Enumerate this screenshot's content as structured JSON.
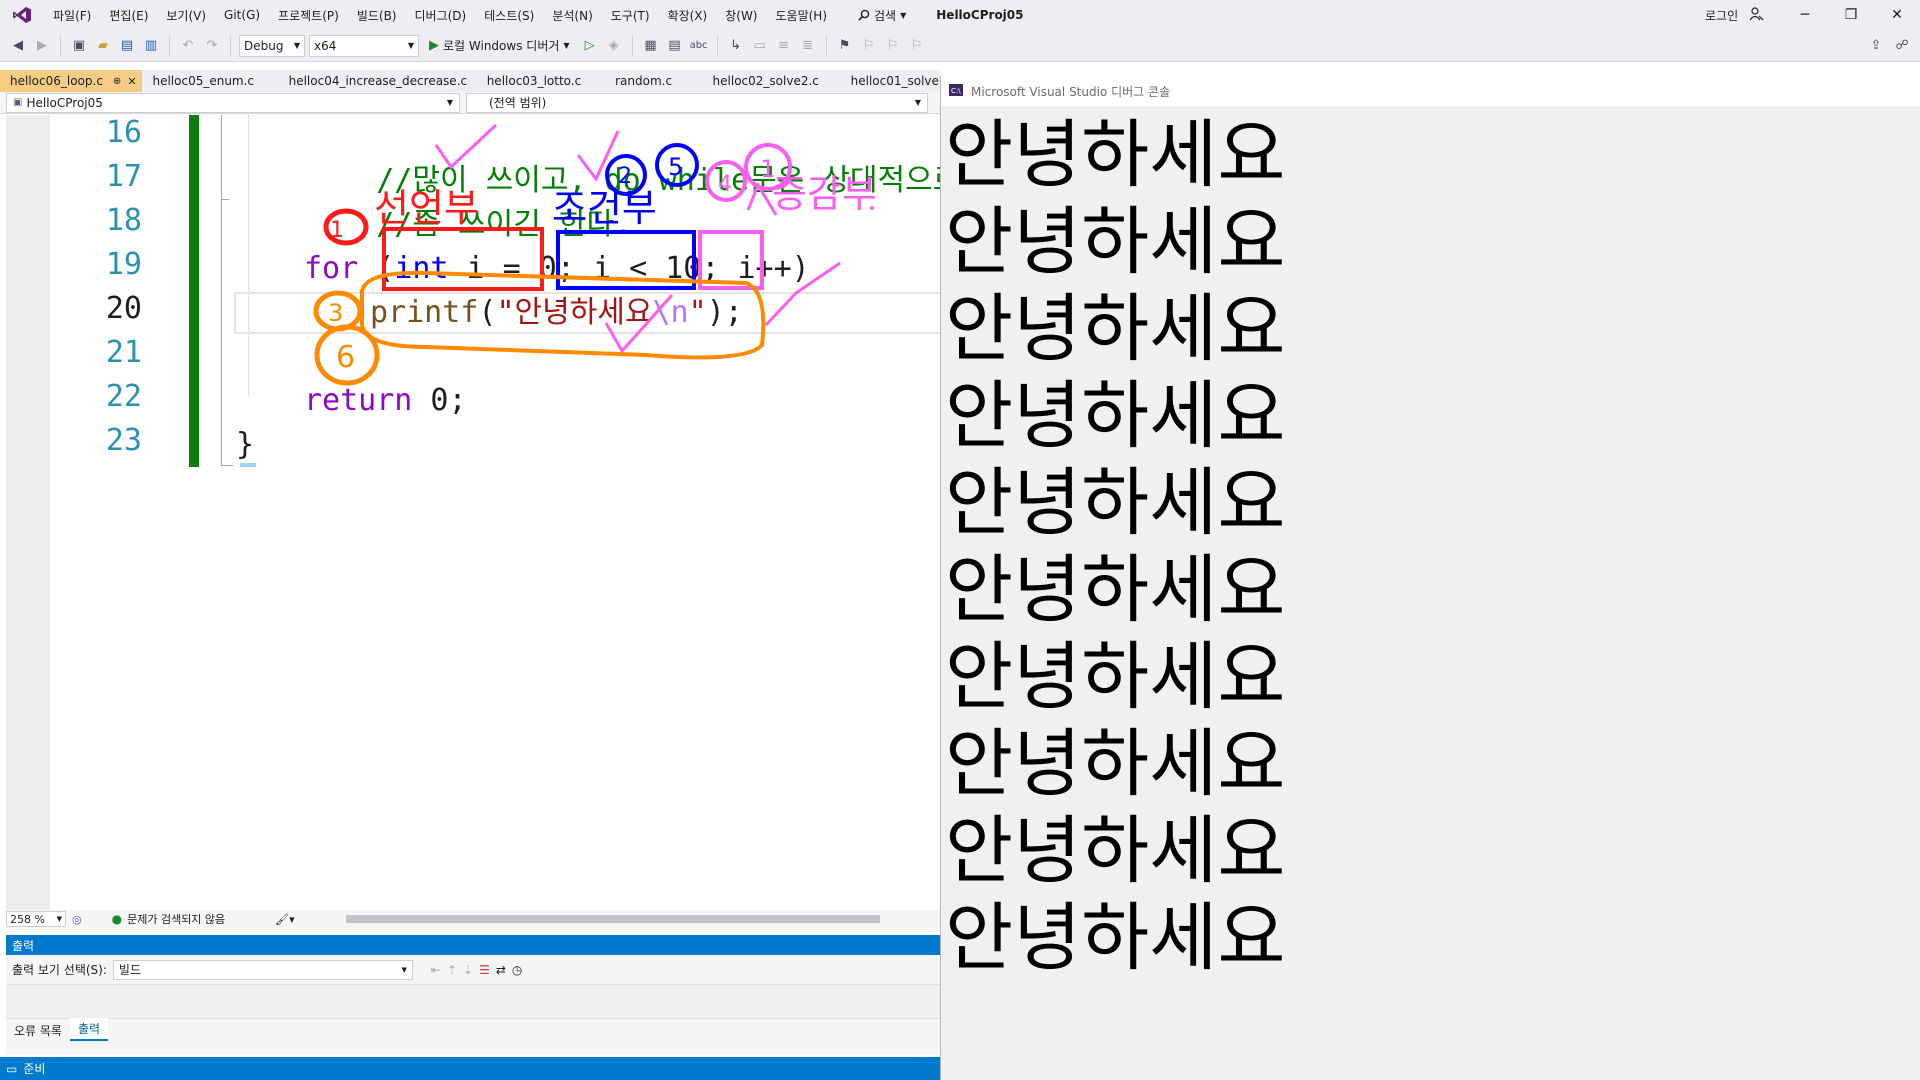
{
  "app": {
    "solution_name": "HelloCProj05",
    "login": "로그인",
    "search_label": "검색"
  },
  "menu": [
    "파일(F)",
    "편집(E)",
    "보기(V)",
    "Git(G)",
    "프로젝트(P)",
    "빌드(B)",
    "디버그(D)",
    "테스트(S)",
    "분석(N)",
    "도구(T)",
    "확장(X)",
    "창(W)",
    "도움말(H)"
  ],
  "toolbar": {
    "configuration": "Debug",
    "platform": "x64",
    "run_label": "로컬 Windows 디버거"
  },
  "tabs": [
    "helloc06_loop.c",
    "helloc05_enum.c",
    "helloc04_increase_decrease.c",
    "helloc03_lotto.c",
    "random.c",
    "helloc02_solve2.c",
    "helloc01_solve"
  ],
  "navbar": {
    "project": "HelloCProj05",
    "scope": "(전역 범위)"
  },
  "editor": {
    "line_numbers": [
      "16",
      "17",
      "18",
      "19",
      "20",
      "21",
      "22",
      "23"
    ],
    "current_line": "20",
    "code": {
      "l16": "//많이 쓰이고, do while문은 상대적으로",
      "l17": "//좀 쓰이긴 한다.",
      "l19_kw": "for",
      "l19_open": " (",
      "l19_type": "int",
      "l19_init": " i = 0; i < 10; i++)",
      "l20_fn": "printf",
      "l20_open": "(",
      "l20_str": "\"안녕하세요",
      "l20_esc": "\\n",
      "l20_strend": "\"",
      "l20_close": ");",
      "l22_kw": "return",
      "l22_rest": " 0;",
      "l23": "}"
    },
    "annotations": {
      "declaration": "선언부",
      "condition": "조건부",
      "increment": "증감부",
      "n1": "1",
      "n2": "2",
      "n3": "3",
      "n4": "4",
      "n5": "5",
      "n6": "6",
      "red": "#ff1a1a",
      "blue": "#0000ff",
      "pink": "#ff5cf0",
      "orange": "#ff8a00"
    }
  },
  "editor_status": {
    "zoom": "258 %",
    "issues": "문제가 검색되지 않음"
  },
  "output": {
    "title": "출력",
    "source_label": "출력 보기 선택(S):",
    "source_value": "빌드"
  },
  "bottom_tabs": [
    "오류 목록",
    "출력"
  ],
  "status": {
    "text": "준비"
  },
  "console": {
    "title": "Microsoft Visual Studio 디버그 콘솔",
    "lines": [
      "안녕하세요",
      "안녕하세요",
      "안녕하세요",
      "안녕하세요",
      "안녕하세요",
      "안녕하세요",
      "안녕하세요",
      "안녕하세요",
      "안녕하세요",
      "안녕하세요"
    ]
  },
  "colors": {
    "accent": "#007acc",
    "active_tab": "#f5cc84",
    "change_bar": "#107c10"
  }
}
